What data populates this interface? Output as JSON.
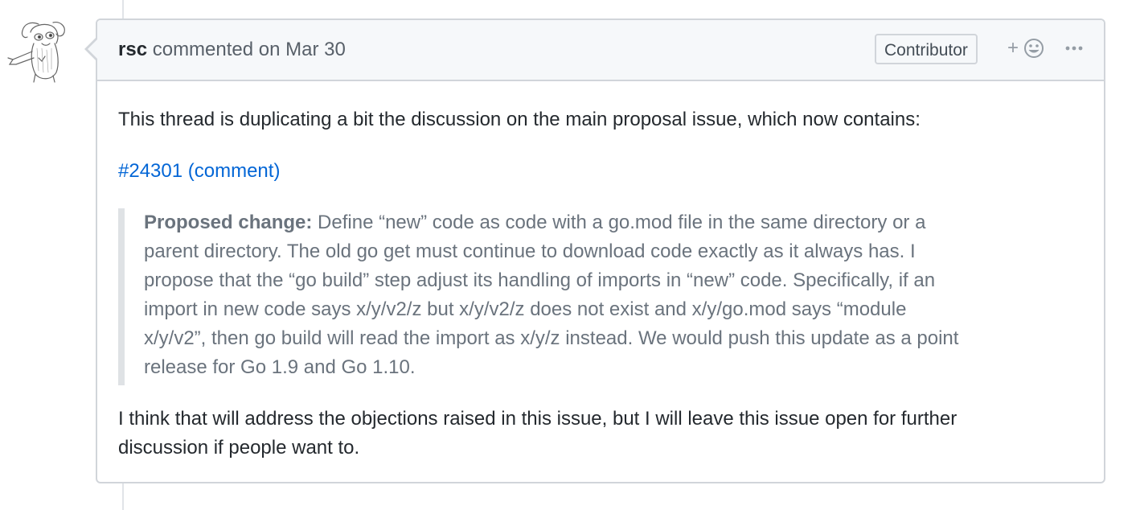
{
  "comment": {
    "author": "rsc",
    "action": "commented on",
    "date": "Mar 30",
    "badge": "Contributor",
    "reaction_plus": "+",
    "icons": {
      "reaction": "smiley-icon",
      "more": "kebab-horizontal-icon",
      "avatar": "avatar-drawing"
    },
    "body": {
      "intro": "This thread is duplicating a bit the discussion on the main proposal issue, which now contains:",
      "link_text": "#24301 (comment)",
      "quote": {
        "strong": "Proposed change:",
        "line1_rest": " Define “new” code as code with a go.mod file in the same directory or a",
        "line2": "parent directory. The old go get must continue to download code exactly as it always has. I",
        "line3": "propose that the “go build” step adjust its handling of imports in “new” code. Specifically, if an",
        "line4": "import in new code says x/y/v2/z but x/y/v2/z does not exist and x/y/go.mod says “module",
        "line5": "x/y/v2”, then go build will read the import as x/y/z instead. We would push this update as a point",
        "line6": "release for Go 1.9 and Go 1.10."
      },
      "closing_line1": "I think that will address the objections raised in this issue, but I will leave this issue open for further",
      "closing_line2": "discussion if people want to."
    }
  },
  "colors": {
    "link": "#0366d6",
    "header_bg": "#f6f8fa",
    "border": "#d1d5da",
    "quote_text": "#6a737d",
    "quote_border": "#dfe2e5"
  }
}
